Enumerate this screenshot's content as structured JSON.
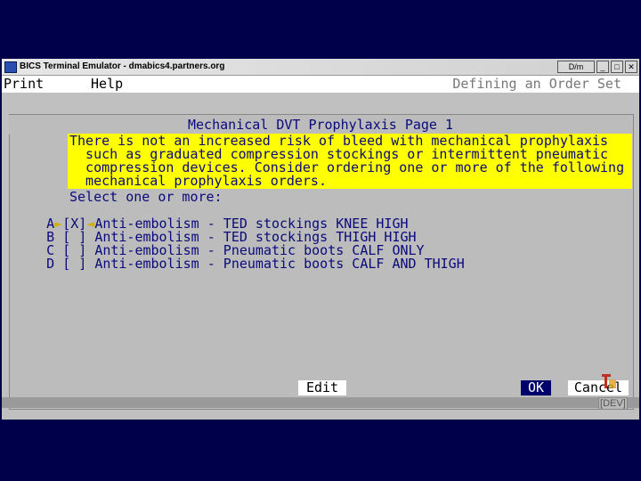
{
  "window": {
    "title": "BICS Terminal Emulator - dmabics4.partners.org",
    "buttons": {
      "restore": "D/m",
      "minimize": "_",
      "maximize": "□",
      "close": "✕"
    }
  },
  "menubar": {
    "print": "Print",
    "help": "Help",
    "status": "Defining an Order Set"
  },
  "screen": {
    "header": "Mechanical DVT Prophylaxis  Page  1",
    "warning": [
      "There is not an increased risk of bleed with mechanical prophylaxis",
      "  such as graduated compression stockings or intermittent pneumatic",
      "  compression devices. Consider ordering one or more of the following",
      "  mechanical prophylaxis orders."
    ],
    "prompt": "Select one or more:",
    "options": [
      {
        "letter": "A",
        "marker": "►",
        "box": "[X]",
        "end": "◄",
        "text": "Anti-embolism - TED stockings KNEE HIGH"
      },
      {
        "letter": "B",
        "marker": " ",
        "box": "[ ]",
        "end": " ",
        "text": "Anti-embolism - TED stockings THIGH HIGH"
      },
      {
        "letter": "C",
        "marker": " ",
        "box": "[ ]",
        "end": " ",
        "text": "Anti-embolism - Pneumatic boots CALF ONLY"
      },
      {
        "letter": "D",
        "marker": " ",
        "box": "[ ]",
        "end": " ",
        "text": "Anti-embolism - Pneumatic boots CALF AND THIGH"
      }
    ]
  },
  "buttons": {
    "edit": "Edit",
    "ok": "OK",
    "cancel": "Cancel"
  },
  "footer": {
    "env": "DEV"
  },
  "colors": {
    "background": "#00004a",
    "warning": "#ffff00",
    "text": "#0a0a7a",
    "ok_bg": "#00006a"
  }
}
